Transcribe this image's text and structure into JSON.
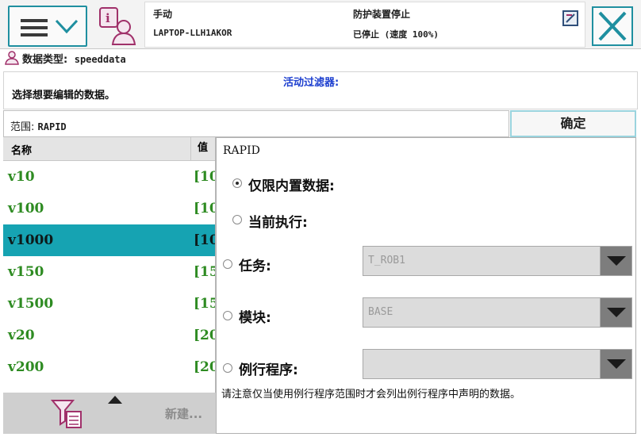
{
  "header": {
    "mode": "手动",
    "host": "LAPTOP-LLH1AKOR",
    "safety_status": "防护装置停止",
    "run_status": "已停止 (速度 100%)"
  },
  "datatype": {
    "label": "数据类型:",
    "value": "speeddata"
  },
  "instructions": {
    "active_filter_label": "活动过滤器:",
    "choose_label": "选择想要编辑的数据。"
  },
  "scope": {
    "label": "范围:",
    "value": "RAPID",
    "ok_label": "确定"
  },
  "list": {
    "headers": {
      "name": "名称",
      "value": "值"
    },
    "rows": [
      {
        "name": "v10",
        "value": "[10",
        "selected": false
      },
      {
        "name": "v100",
        "value": "[10",
        "selected": false
      },
      {
        "name": "v1000",
        "value": "[10",
        "selected": true
      },
      {
        "name": "v150",
        "value": "[15",
        "selected": false
      },
      {
        "name": "v1500",
        "value": "[15",
        "selected": false
      },
      {
        "name": "v20",
        "value": "[20",
        "selected": false
      },
      {
        "name": "v200",
        "value": "[20",
        "selected": false
      }
    ]
  },
  "bottombar": {
    "new_label": "新建..."
  },
  "filter_popup": {
    "title": "RAPID",
    "options": {
      "builtin": "仅限内置数据:",
      "current": "当前执行:",
      "task": "任务:",
      "module": "模块:",
      "routine": "例行程序:"
    },
    "task_value": "T_ROB1",
    "module_value": "BASE",
    "routine_value": "",
    "selected_option": "builtin",
    "note": "请注意仅当使用例行程序范围时才会列出例行程序中声明的数据。"
  },
  "colors": {
    "accent": "#16a3b2",
    "link_blue": "#1d3fcf",
    "value_green": "#2e8b22"
  }
}
